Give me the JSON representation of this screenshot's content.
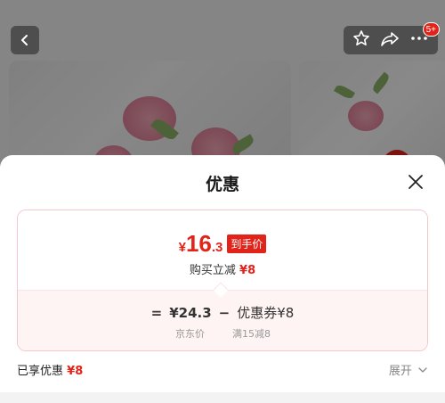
{
  "nav": {
    "back_icon": "chevron-left-icon",
    "star_icon": "star-icon",
    "share_icon": "share-icon",
    "more_icon": "more-icon",
    "badge": "5+"
  },
  "sheet": {
    "title": "优惠",
    "price": {
      "currency": "¥",
      "integer": "16",
      "decimal": ".3",
      "tag": "到手价"
    },
    "discount_text": "购买立减",
    "discount_value": "¥8",
    "calc": {
      "equals": "=",
      "base_price": "¥24.3",
      "minus": "−",
      "coupon": "优惠券¥8",
      "base_label": "京东价",
      "coupon_label": "满15减8"
    },
    "enjoyed_label": "已享优惠",
    "enjoyed_value": "¥8",
    "expand_label": "展开"
  },
  "colors": {
    "accent": "#e2231a"
  }
}
